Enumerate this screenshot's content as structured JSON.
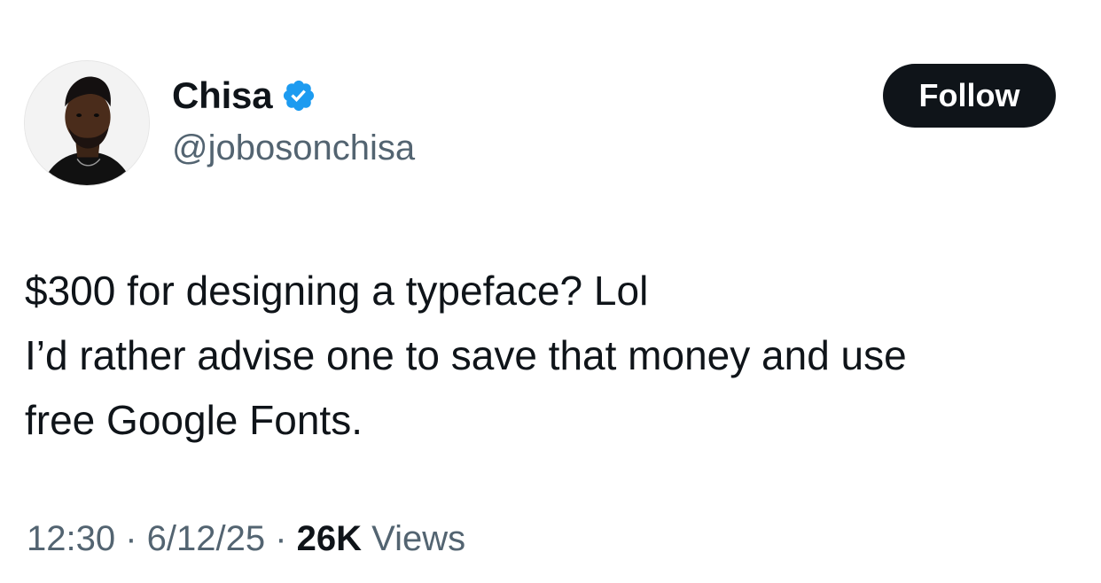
{
  "author": {
    "display_name": "Chisa",
    "handle": "@jobosonchisa",
    "verified": true,
    "verified_color": "#1d9bf0"
  },
  "actions": {
    "follow_label": "Follow"
  },
  "tweet": {
    "lines": [
      "$300 for designing a typeface? Lol",
      "I’d rather advise one to save that money and use",
      "free Google Fonts."
    ]
  },
  "meta": {
    "time": "12:30",
    "separator": " · ",
    "date": "6/12/25",
    "views_count": "26K",
    "views_label": " Views"
  },
  "colors": {
    "text": "#0f1419",
    "secondary": "#536471",
    "button_bg": "#0f1419"
  }
}
